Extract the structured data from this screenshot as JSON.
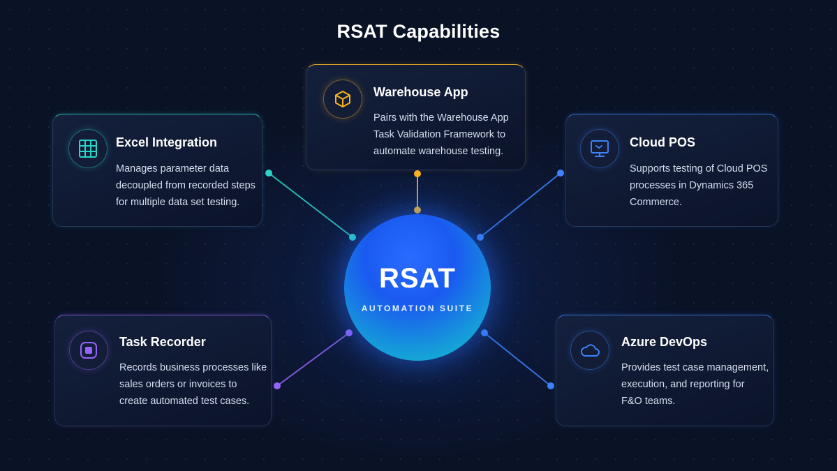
{
  "title": "RSAT Capabilities",
  "hub": {
    "title": "RSAT",
    "subtitle": "AUTOMATION SUITE"
  },
  "cards": [
    {
      "id": "excel",
      "title": "Excel Integration",
      "icon": "grid-icon",
      "accent": "#2dd4c8",
      "lines": [
        "Manages parameter data",
        "decoupled from recorded steps",
        "for multiple data set testing."
      ]
    },
    {
      "id": "warehouse",
      "title": "Warehouse App",
      "icon": "box-icon",
      "accent": "#fbb41e",
      "lines": [
        "Pairs with the Warehouse App",
        "Task Validation Framework to",
        "automate warehouse testing."
      ]
    },
    {
      "id": "cloud",
      "title": "Cloud POS",
      "icon": "monitor-icon",
      "accent": "#3c82fa",
      "lines": [
        "Supports testing of Cloud POS",
        "processes in Dynamics 365",
        "Commerce."
      ]
    },
    {
      "id": "task",
      "title": "Task Recorder",
      "icon": "record-icon",
      "accent": "#9664fa",
      "lines": [
        "Records business processes like",
        "sales orders or invoices to",
        "create automated test cases."
      ]
    },
    {
      "id": "azure",
      "title": "Azure DevOps",
      "icon": "cloud-icon",
      "accent": "#3c82fa",
      "lines": [
        "Provides test case management,",
        "execution, and reporting for",
        "F&O teams."
      ]
    }
  ]
}
